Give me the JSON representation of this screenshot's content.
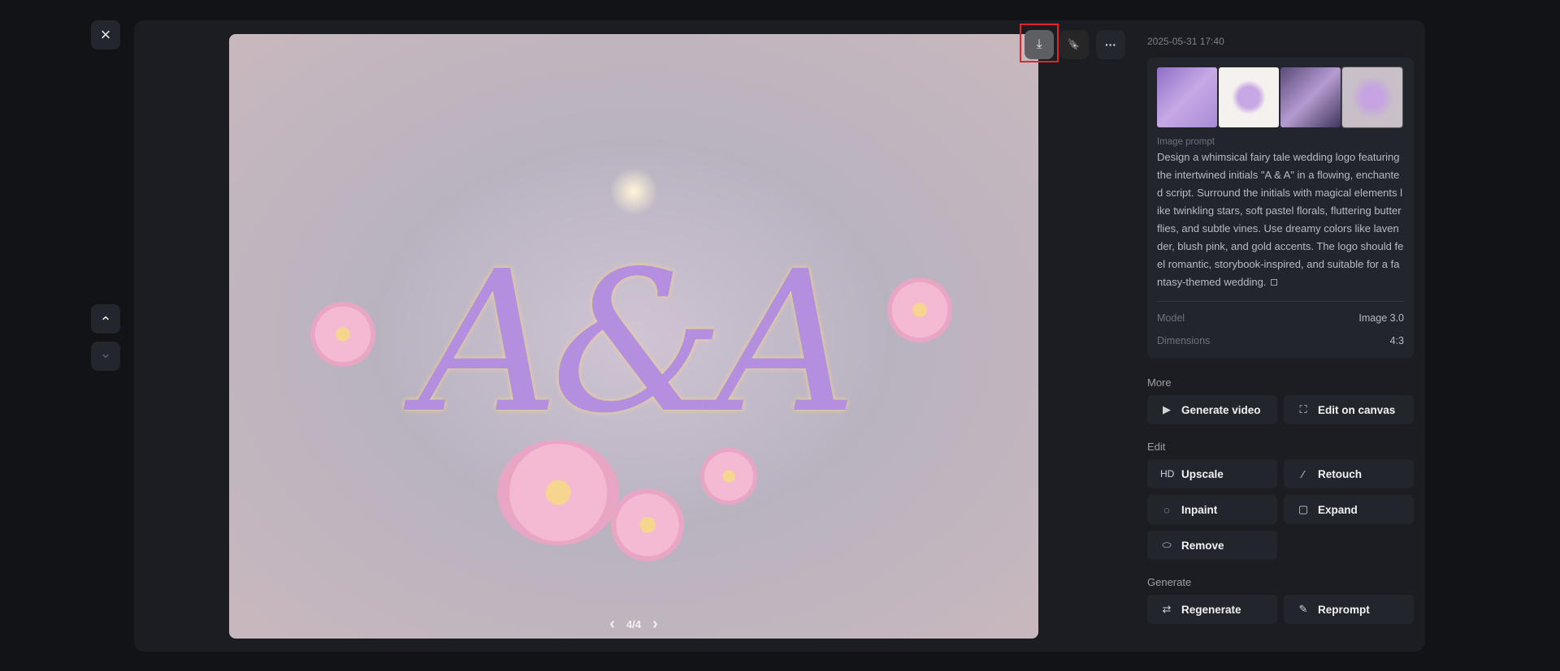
{
  "viewer": {
    "close_icon": "×",
    "up_icon": "⌃",
    "down_icon": "⌄",
    "pager": {
      "prev": "‹",
      "label": "4/4",
      "next": "›"
    },
    "image_monogram": "A&A"
  },
  "toolbar": {
    "download_icon": "⤓",
    "bookmark_icon": "🔖",
    "more_icon": "···"
  },
  "details": {
    "timestamp": "2025-05-31 17:40",
    "prompt_label": "Image prompt",
    "prompt": "Design a whimsical fairy tale wedding logo featuring the intertwined initials \"A & A\" in a flowing, enchanted script. Surround the initials with magical elements like twinkling stars, soft pastel florals, fluttering butterflies, and subtle vines. Use dreamy colors like lavender, blush pink, and gold accents. The logo should feel romantic, storybook-inspired, and suitable for a fantasy-themed wedding.",
    "model_label": "Model",
    "model": "Image 3.0",
    "dimensions_label": "Dimensions",
    "dimensions": "4:3"
  },
  "sections": {
    "more": {
      "label": "More",
      "generate_video": "Generate video",
      "edit_on_canvas": "Edit on canvas"
    },
    "edit": {
      "label": "Edit",
      "upscale_icon": "HD",
      "upscale": "Upscale",
      "retouch": "Retouch",
      "inpaint": "Inpaint",
      "expand": "Expand",
      "remove": "Remove"
    },
    "generate": {
      "label": "Generate",
      "regenerate": "Regenerate",
      "reprompt": "Reprompt"
    }
  },
  "colors": {
    "highlight": "#e0262b",
    "panel": "#1b1d22",
    "button": "#22252c"
  }
}
